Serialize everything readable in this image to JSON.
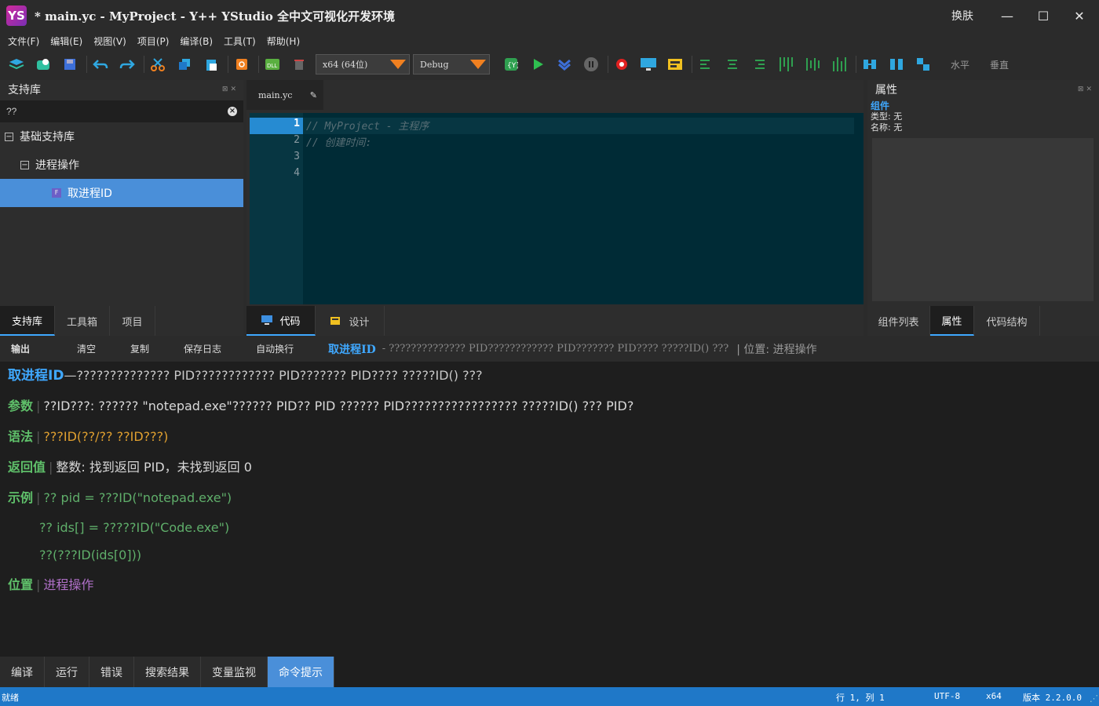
{
  "window": {
    "logo": "YS",
    "title": "* main.yc - MyProject - Y++ YStudio 全中文可视化开发环境",
    "skin": "换肤",
    "minimize": "—",
    "maximize": "☐",
    "close": "✕"
  },
  "menu": [
    "文件(F)",
    "编辑(E)",
    "视图(V)",
    "项目(P)",
    "编译(B)",
    "工具(T)",
    "帮助(H)"
  ],
  "toolbar": {
    "platform": "x64 (64位)",
    "config": "Debug",
    "horizontal": "水平",
    "vertical": "垂直"
  },
  "left_panel": {
    "title": "支持库",
    "search_value": "??",
    "tree": {
      "root": "基础支持库",
      "group": "进程操作",
      "item": "取进程ID",
      "item_icon": "F"
    },
    "tabs": [
      "支持库",
      "工具箱",
      "项目"
    ]
  },
  "editor": {
    "tab": "main.yc",
    "line_numbers": [
      "1",
      "2",
      "3",
      "4"
    ],
    "lines": [
      "// MyProject - 主程序",
      "// 创建时间:",
      "",
      ""
    ],
    "tabs": [
      "代码",
      "设计"
    ]
  },
  "right_panel": {
    "title": "属性",
    "component": "组件",
    "type": "类型: 无",
    "name": "名称: 无",
    "tabs": [
      "组件列表",
      "属性",
      "代码结构"
    ]
  },
  "output": {
    "title": "输出",
    "buttons": [
      "清空",
      "复制",
      "保存日志",
      "自动换行"
    ],
    "cmd_name": "取进程ID",
    "cmd_desc": "- ?????????????? PID???????????? PID??????? PID???? ?????ID() ???",
    "location": "| 位置: 进程操作",
    "help": {
      "name": "取进程ID",
      "summary": "—?????????????? PID???????????? PID??????? PID???? ?????ID() ???",
      "param_label": "参数",
      "param_text": "??ID???: ?????? \"notepad.exe\"?????? PID?? PID ?????? PID????????????????? ?????ID() ??? PID?",
      "syntax_label": "语法",
      "syntax_text": "???ID(??/?? ??ID???)",
      "return_label": "返回值",
      "return_text": "整数: 找到返回 PID，未找到返回 0",
      "example_label": "示例",
      "example_lines": [
        "?? pid = ???ID(\"notepad.exe\")",
        "?? ids[] = ?????ID(\"Code.exe\")",
        "??(???ID(ids[0]))"
      ],
      "location_label": "位置",
      "location_text": "进程操作"
    },
    "tabs": [
      "编译",
      "运行",
      "错误",
      "搜索结果",
      "变量监视",
      "命令提示"
    ]
  },
  "status": {
    "ready": "就绪",
    "position": "行 1, 列 1",
    "encoding": "UTF-8",
    "arch": "x64",
    "version": "版本 2.2.0.0"
  },
  "colors": {
    "accent": "#4a8fd9",
    "status_bar": "#1f78c8",
    "editor_bg": "#002b36"
  }
}
